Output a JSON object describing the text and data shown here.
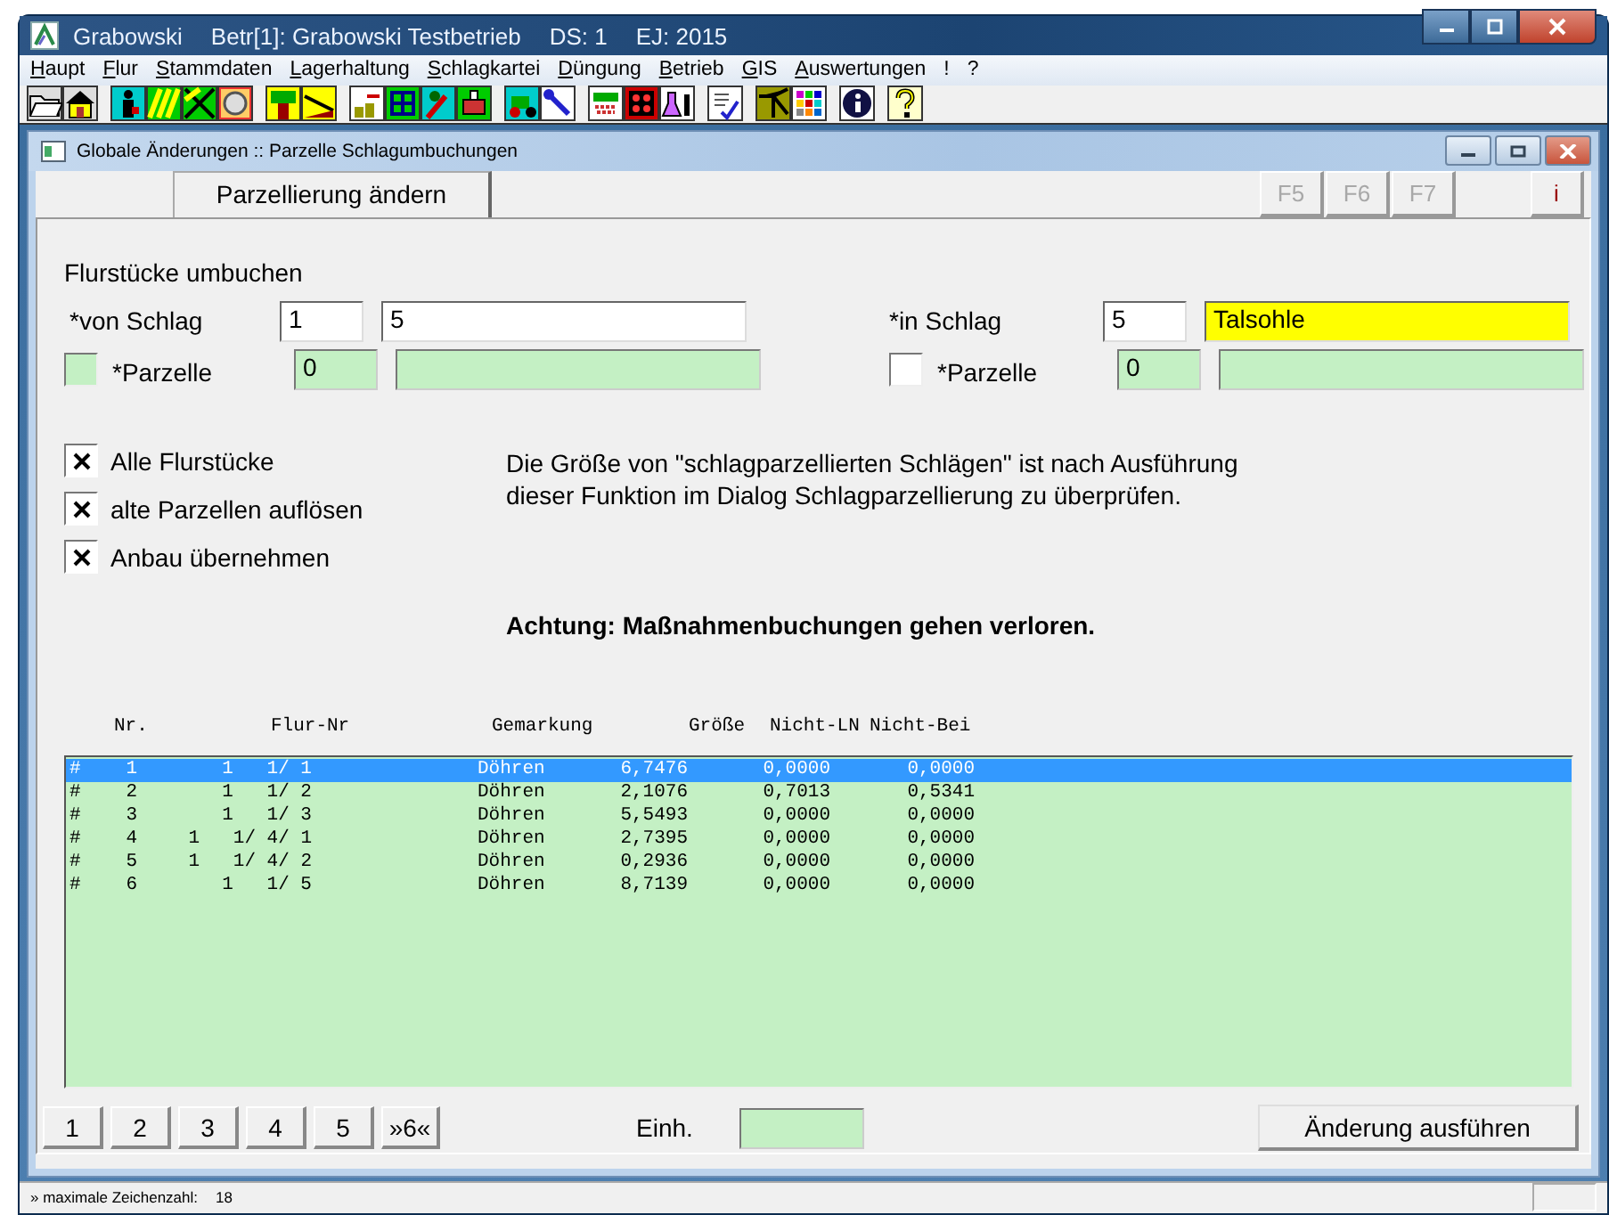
{
  "window": {
    "title_parts": [
      "Grabowski",
      "Betr[1]: Grabowski Testbetrieb",
      "DS: 1",
      "EJ: 2015"
    ]
  },
  "menu": [
    "Haupt",
    "Flur",
    "Stammdaten",
    "Lagerhaltung",
    "Schlagkartei",
    "Düngung",
    "Betrieb",
    "GIS",
    "Auswertungen",
    "!",
    "?"
  ],
  "child_window": {
    "title": "Globale Änderungen :: Parzelle Schlagumbuchungen"
  },
  "tab": {
    "label": "Parzellierung ändern"
  },
  "function_keys": [
    {
      "label": "F5",
      "disabled": true
    },
    {
      "label": "F6",
      "disabled": true
    },
    {
      "label": "F7",
      "disabled": true
    },
    {
      "label": "i",
      "disabled": false
    }
  ],
  "section_title": "Flurstücke umbuchen",
  "transfer": [
    {
      "label": "*von Schlag",
      "fields": [
        {
          "value": "1",
          "readonly": false,
          "highlighted": false
        },
        {
          "value": "5",
          "readonly": false,
          "highlighted": false
        }
      ],
      "parcel": {
        "label": "*Parzelle",
        "disabled": true,
        "fields": [
          {
            "value": "0",
            "readonly": true,
            "highlighted": false
          },
          {
            "readonly": true,
            "highlighted": false
          }
        ]
      }
    },
    {
      "label": "*in Schlag",
      "fields": [
        {
          "value": "5",
          "readonly": false,
          "highlighted": false
        },
        {
          "value": "Talsohle",
          "readonly": false,
          "highlighted": true
        }
      ],
      "parcel": {
        "label": "*Parzelle",
        "disabled": false,
        "fields": [
          {
            "value": "0",
            "readonly": true,
            "highlighted": false
          },
          {
            "readonly": true,
            "highlighted": false
          }
        ]
      }
    }
  ],
  "options": [
    {
      "label": "Alle Flurstücke",
      "checked": true
    },
    {
      "label": "alte Parzellen auflösen",
      "checked": true
    },
    {
      "label": "Anbau übernehmen",
      "checked": true
    }
  ],
  "info": {
    "text": "Die Größe von \"schlagparzellierten Schlägen\" ist nach Ausführung dieser Funktion im Dialog Schlagparzellierung zu überprüfen.",
    "warning": "Achtung: Maßnahmenbuchungen gehen verloren."
  },
  "table": {
    "columns": [
      "Nr.",
      "Flur-Nr",
      "Gemarkung",
      "Größe",
      "Nicht-LN",
      "Nicht-Bei"
    ],
    "rows": [
      {
        "marker": "#",
        "cells": [
          "1",
          "1   1/ 1",
          "Döhren",
          "6,7476",
          "0,0000",
          "0,0000"
        ],
        "selected": true
      },
      {
        "marker": "#",
        "cells": [
          "2",
          "1   1/ 2",
          "Döhren",
          "2,1076",
          "0,7013",
          "0,5341"
        ],
        "selected": false
      },
      {
        "marker": "#",
        "cells": [
          "3",
          "1   1/ 3",
          "Döhren",
          "5,5493",
          "0,0000",
          "0,0000"
        ],
        "selected": false
      },
      {
        "marker": "#",
        "cells": [
          "4",
          "1   1/ 4/ 1",
          "Döhren",
          "2,7395",
          "0,0000",
          "0,0000"
        ],
        "selected": false
      },
      {
        "marker": "#",
        "cells": [
          "5",
          "1   1/ 4/ 2",
          "Döhren",
          "0,2936",
          "0,0000",
          "0,0000"
        ],
        "selected": false
      },
      {
        "marker": "#",
        "cells": [
          "6",
          "1   1/ 5",
          "Döhren",
          "8,7139",
          "0,0000",
          "0,0000"
        ],
        "selected": false
      }
    ]
  },
  "pages": [
    "1",
    "2",
    "3",
    "4",
    "5",
    "»6«"
  ],
  "units": {
    "label": "Einh.",
    "readonly": true
  },
  "execute_button": "Änderung ausführen",
  "status_bar": [
    "» maximale Zeichenzahl:",
    "18"
  ]
}
